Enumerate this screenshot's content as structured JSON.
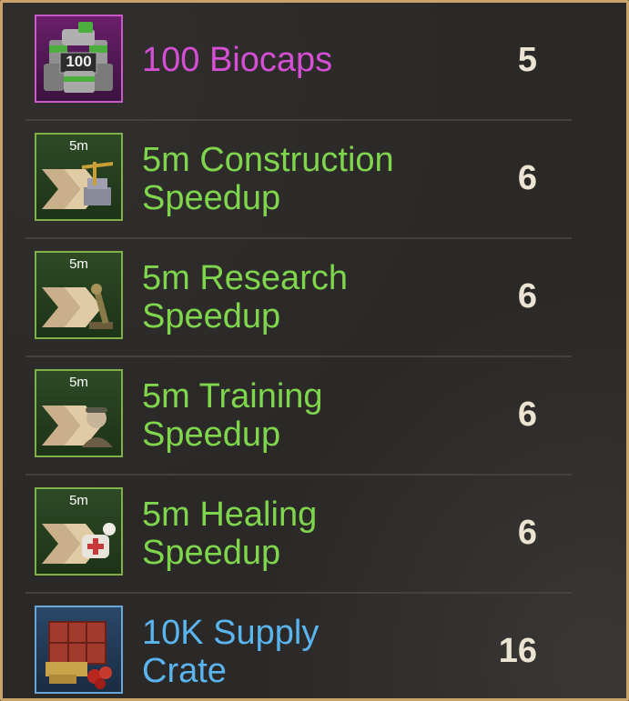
{
  "items": [
    {
      "name_line1": "100 Biocaps",
      "name_line2": "",
      "quantity": "5",
      "rarity_color": "#d44fd4",
      "icon": "biocaps-icon",
      "icon_tag": "100"
    },
    {
      "name_line1": "5m Construction",
      "name_line2": "Speedup",
      "quantity": "6",
      "rarity_color": "#7fd64d",
      "icon": "construction-speedup-icon",
      "icon_tag": "5m"
    },
    {
      "name_line1": "5m Research",
      "name_line2": "Speedup",
      "quantity": "6",
      "rarity_color": "#7fd64d",
      "icon": "research-speedup-icon",
      "icon_tag": "5m"
    },
    {
      "name_line1": "5m Training",
      "name_line2": "Speedup",
      "quantity": "6",
      "rarity_color": "#7fd64d",
      "icon": "training-speedup-icon",
      "icon_tag": "5m"
    },
    {
      "name_line1": "5m Healing",
      "name_line2": "Speedup",
      "quantity": "6",
      "rarity_color": "#7fd64d",
      "icon": "healing-speedup-icon",
      "icon_tag": "5m"
    },
    {
      "name_line1": "10K Supply",
      "name_line2": "Crate",
      "quantity": "16",
      "rarity_color": "#5ab4ee",
      "icon": "supply-crate-icon",
      "icon_tag": ""
    }
  ],
  "colors": {
    "frame_border": "#c9a46a",
    "background": "#2b2927"
  }
}
